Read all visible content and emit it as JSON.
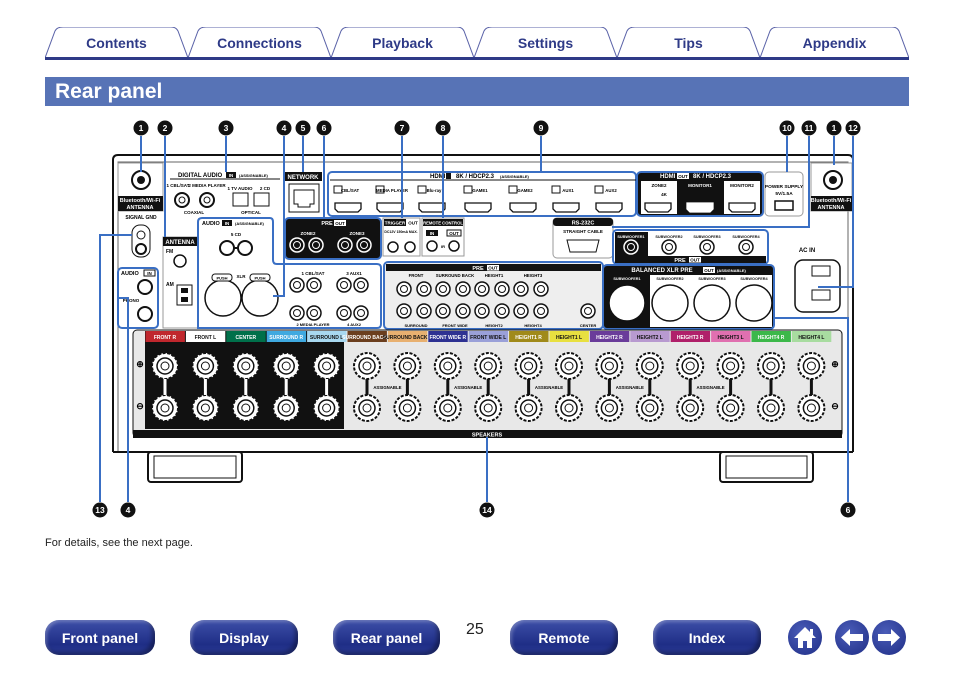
{
  "tabs": [
    {
      "label": "Contents"
    },
    {
      "label": "Connections"
    },
    {
      "label": "Playback"
    },
    {
      "label": "Settings"
    },
    {
      "label": "Tips"
    },
    {
      "label": "Appendix"
    }
  ],
  "page_title": "Rear panel",
  "diagram": {
    "callouts_top": [
      "1",
      "2",
      "3",
      "4",
      "5",
      "6",
      "7",
      "8",
      "9",
      "10",
      "11",
      "1",
      "12"
    ],
    "callouts_bottom": [
      "13",
      "4",
      "14",
      "6"
    ],
    "bt_antenna": "Bluetooth/Wi-Fi",
    "bt_antenna2": "ANTENNA",
    "signal_gnd": "SIGNAL GND",
    "digital_audio": "DIGITAL AUDIO",
    "in": "IN",
    "out": "OUT",
    "assignable_paren": "(ASSIGNABLE)",
    "digital_inputs": [
      "1 CBL/SAT",
      "2 MEDIA PLAYER",
      "1 TV AUDIO",
      "2 CD"
    ],
    "coaxial": "COAXIAL",
    "optical": "OPTICAL",
    "network": "NETWORK",
    "hdmi": "HDMI",
    "hdmi_spec": "8K / HDCP2.3",
    "hdmi_inputs": [
      "CBL/SAT",
      "MEDIA PLAYER",
      "Blu-ray",
      "GAME1",
      "GAME2",
      "AUX1",
      "AUX2"
    ],
    "hdmi_outputs": [
      "ZONE2",
      "MONITOR1",
      "MONITOR2"
    ],
    "zone2_4k": "4K",
    "power_supply": "POWER SUPPLY",
    "power_rating": "5V/1.5A",
    "antenna": "ANTENNA",
    "fm": "FM",
    "am": "AM",
    "audio": "AUDIO",
    "phono": "PHONO",
    "cd": "5 CD",
    "xlr": "XLR",
    "push": "PUSH",
    "audio_pairs": [
      "1 CBL/SAT",
      "3 AUX1",
      "2 MEDIA PLAYER",
      "4 AUX2"
    ],
    "pre": "PRE",
    "zone_outs": [
      "ZONE2",
      "ZONE3"
    ],
    "trigger": "TRIGGER",
    "trigger_spec": "DC12V 150mA MAX.",
    "remote_control": "REMOTE CONTROL",
    "ir": "IR",
    "rs232c": "RS-232C",
    "straight_cable": "STRAIGHT CABLE",
    "subwoofers": [
      "SUBWOOFER1",
      "SUBWOOFER2",
      "SUBWOOFER3",
      "SUBWOOFER4"
    ],
    "balanced_xlr_pre": "BALANCED XLR PRE",
    "pre_out_top": [
      "FRONT",
      "SURROUND BACK",
      "HEIGHT1",
      "HEIGHT3"
    ],
    "pre_out_bottom": [
      "SURROUND",
      "FRONT WIDE",
      "HEIGHT2",
      "HEIGHT4",
      "CENTER"
    ],
    "ac_in": "AC IN",
    "speakers": "SPEAKERS",
    "assignable": "ASSIGNABLE",
    "speaker_channels": [
      {
        "label": "FRONT R",
        "color": "#c0272d",
        "text": "#ffffff"
      },
      {
        "label": "FRONT L",
        "color": "#ffffff",
        "text": "#111111"
      },
      {
        "label": "CENTER",
        "color": "#00704a",
        "text": "#ffffff"
      },
      {
        "label": "SURROUND R",
        "color": "#3fa9e0",
        "text": "#ffffff"
      },
      {
        "label": "SURROUND L",
        "color": "#a8d8f0",
        "text": "#111111"
      },
      {
        "label": "SURROUND BACK R",
        "color": "#6b3e1e",
        "text": "#ffffff"
      },
      {
        "label": "SURROUND BACK L",
        "color": "#e8b070",
        "text": "#111111"
      },
      {
        "label": "FRONT WIDE R",
        "color": "#2e3192",
        "text": "#ffffff"
      },
      {
        "label": "FRONT WIDE L",
        "color": "#9aa0d8",
        "text": "#111111"
      },
      {
        "label": "HEIGHT1 R",
        "color": "#a08a1a",
        "text": "#ffffff"
      },
      {
        "label": "HEIGHT1 L",
        "color": "#e8e040",
        "text": "#111111"
      },
      {
        "label": "HEIGHT2 R",
        "color": "#6a3c9a",
        "text": "#ffffff"
      },
      {
        "label": "HEIGHT2 L",
        "color": "#b89ad0",
        "text": "#111111"
      },
      {
        "label": "HEIGHT3 R",
        "color": "#b0206a",
        "text": "#ffffff"
      },
      {
        "label": "HEIGHT3 L",
        "color": "#e070b0",
        "text": "#111111"
      },
      {
        "label": "HEIGHT4 R",
        "color": "#3cb84a",
        "text": "#ffffff"
      },
      {
        "label": "HEIGHT4 L",
        "color": "#a8dca0",
        "text": "#111111"
      }
    ],
    "callout_color": "#3a6fc4"
  },
  "note": "For details, see the next page.",
  "footer": {
    "buttons": [
      "Front panel",
      "Display",
      "Rear panel",
      "Remote",
      "Index"
    ],
    "page_number": "25",
    "icons": [
      "home-icon",
      "back-arrow-icon",
      "forward-arrow-icon"
    ]
  }
}
